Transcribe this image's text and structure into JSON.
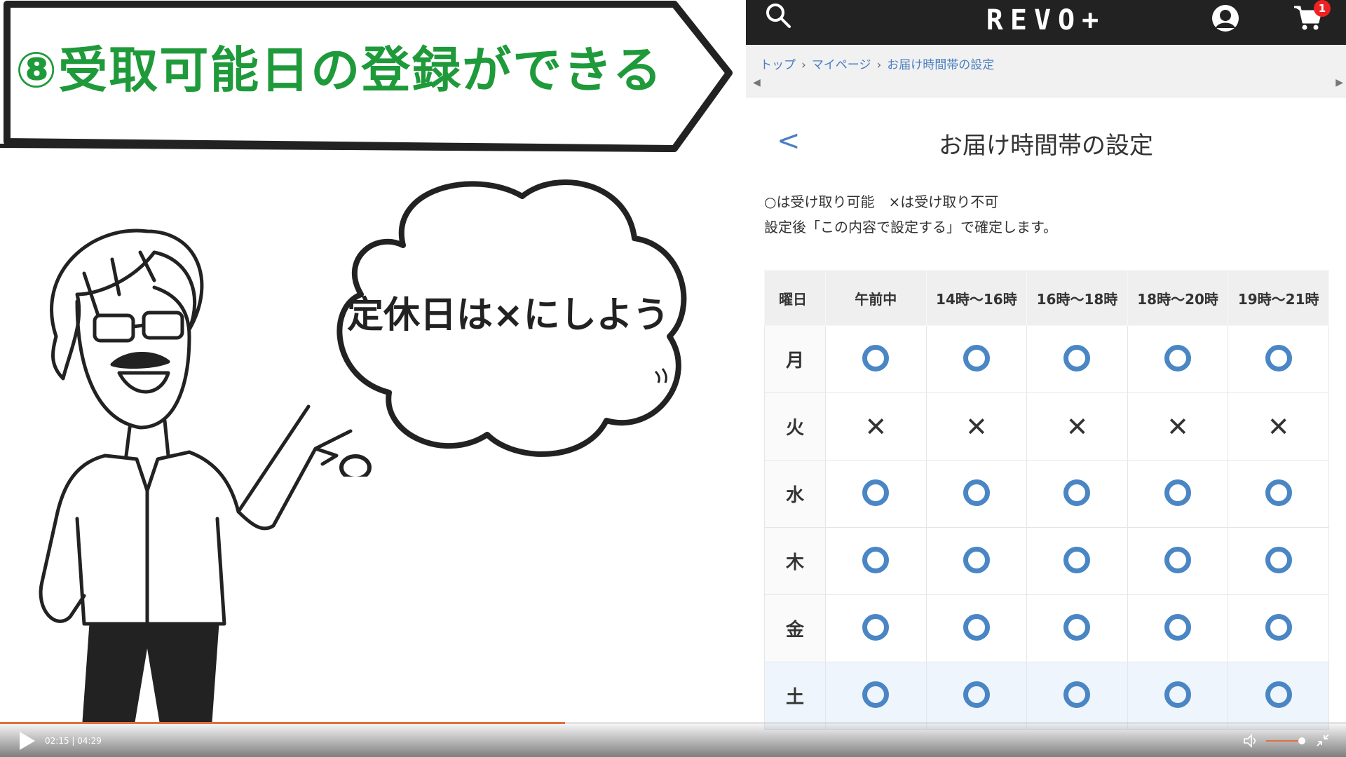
{
  "banner": {
    "title": "⑧受取可能日の登録ができる"
  },
  "speech": {
    "text": "定休日は×にしよう"
  },
  "site": {
    "logo": "REVO+",
    "cart_count": "1",
    "breadcrumb": [
      "トップ",
      "マイページ",
      "お届け時間帯の設定"
    ],
    "page_title": "お届け時間帯の設定",
    "back_label": "<",
    "note_line1": "○は受け取り可能　×は受け取り不可",
    "note_line2": "設定後「この内容で設定する」で確定します。",
    "colors": {
      "accent": "#4a86c4",
      "header": "#222222",
      "banner_text": "#1f9a3a"
    }
  },
  "schedule": {
    "columns": [
      "曜日",
      "午前中",
      "14時〜16時",
      "16時〜18時",
      "18時〜20時",
      "19時〜21時"
    ],
    "rows": [
      {
        "day": "月",
        "slots": [
          "o",
          "o",
          "o",
          "o",
          "o"
        ]
      },
      {
        "day": "火",
        "slots": [
          "x",
          "x",
          "x",
          "x",
          "x"
        ]
      },
      {
        "day": "水",
        "slots": [
          "o",
          "o",
          "o",
          "o",
          "o"
        ]
      },
      {
        "day": "木",
        "slots": [
          "o",
          "o",
          "o",
          "o",
          "o"
        ]
      },
      {
        "day": "金",
        "slots": [
          "o",
          "o",
          "o",
          "o",
          "o"
        ]
      },
      {
        "day": "土",
        "slots": [
          "o",
          "o",
          "o",
          "o",
          "o"
        ]
      }
    ]
  },
  "video": {
    "time": "02:15 | 04:29",
    "progress": 0.42,
    "volume": 0.85,
    "icons": [
      "play-icon",
      "volume-icon",
      "fullscreen-exit-icon"
    ]
  }
}
